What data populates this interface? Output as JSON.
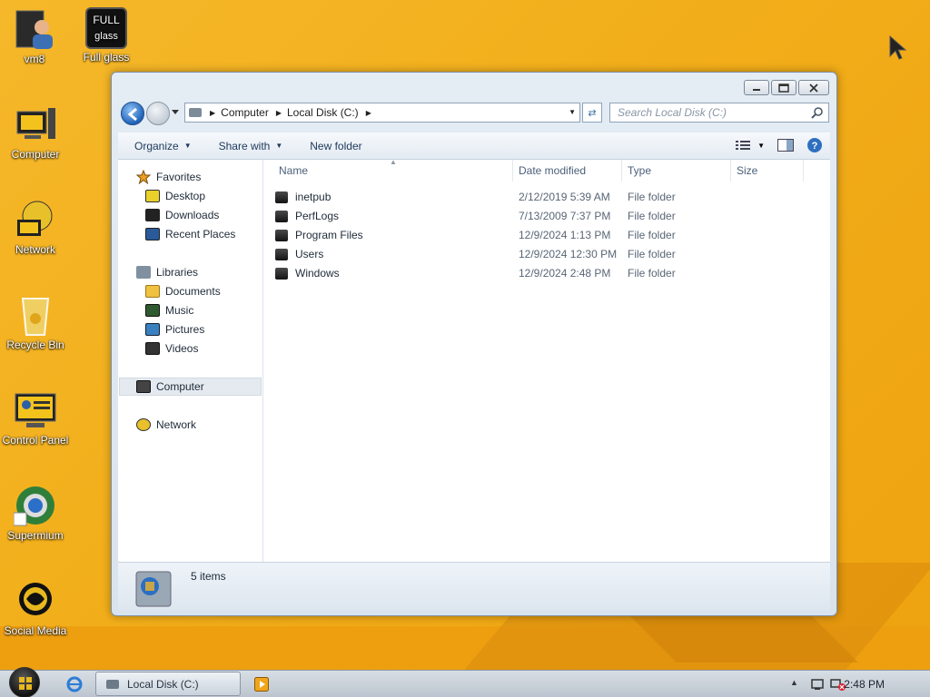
{
  "desktop": {
    "icons": [
      {
        "label": "vm8",
        "icon": "user-folder-icon"
      },
      {
        "label": "Full glass",
        "icon": "fullglass-icon",
        "badge_top": "FULL",
        "badge_bottom": "glass"
      },
      {
        "label": "Computer",
        "icon": "computer-icon"
      },
      {
        "label": "Network",
        "icon": "network-icon"
      },
      {
        "label": "Recycle Bin",
        "icon": "recycle-bin-icon"
      },
      {
        "label": "Control Panel",
        "icon": "control-panel-icon"
      },
      {
        "label": "Supermium",
        "icon": "supermium-icon"
      },
      {
        "label": "Social Media",
        "icon": "social-media-icon"
      }
    ]
  },
  "explorer": {
    "address": {
      "segments": [
        "Computer",
        "Local Disk (C:)"
      ]
    },
    "search": {
      "placeholder": "Search Local Disk (C:)"
    },
    "toolbar": {
      "organize": "Organize",
      "share_with": "Share with",
      "new_folder": "New folder"
    },
    "nav": {
      "favorites": {
        "label": "Favorites",
        "items": [
          "Desktop",
          "Downloads",
          "Recent Places"
        ]
      },
      "libraries": {
        "label": "Libraries",
        "items": [
          "Documents",
          "Music",
          "Pictures",
          "Videos"
        ]
      },
      "computer": "Computer",
      "network": "Network"
    },
    "columns": {
      "name": "Name",
      "date": "Date modified",
      "type": "Type",
      "size": "Size"
    },
    "files": [
      {
        "name": "inetpub",
        "date": "2/12/2019 5:39 AM",
        "type": "File folder"
      },
      {
        "name": "PerfLogs",
        "date": "7/13/2009 7:37 PM",
        "type": "File folder"
      },
      {
        "name": "Program Files",
        "date": "12/9/2024 1:13 PM",
        "type": "File folder"
      },
      {
        "name": "Users",
        "date": "12/9/2024 12:30 PM",
        "type": "File folder"
      },
      {
        "name": "Windows",
        "date": "12/9/2024 2:48 PM",
        "type": "File folder"
      }
    ],
    "details": {
      "count": "5 items"
    }
  },
  "taskbar": {
    "task": "Local Disk (C:)",
    "clock": "2:48 PM"
  },
  "colors": {
    "accent": "#2063b8",
    "wallpaper": "#f2ae1a"
  }
}
